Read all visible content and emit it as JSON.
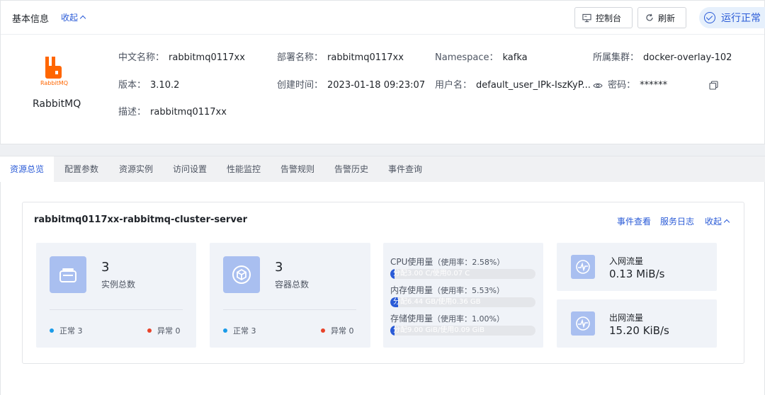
{
  "header": {
    "title": "基本信息",
    "collapse_label": "收起",
    "console_label": "控制台",
    "refresh_label": "刷新",
    "status_label": "运行正常"
  },
  "app": {
    "logo_text": "RabbitMQ",
    "name": "RabbitMQ"
  },
  "info": {
    "cn_name_label": "中文名称：",
    "cn_name": "rabbitmq0117xx",
    "deploy_name_label": "部署名称：",
    "deploy_name": "rabbitmq0117xx",
    "namespace_label": "Namespace：",
    "namespace": "kafka",
    "cluster_label": "所属集群：",
    "cluster": "docker-overlay-102",
    "version_label": "版本：",
    "version": "3.10.2",
    "created_label": "创建时间：",
    "created": "2023-01-18 09:23:07",
    "username_label": "用户名：",
    "username": "default_user_IPk-IszKyP...",
    "password_label": "密码：",
    "password": "******",
    "desc_label": "描述：",
    "desc": "rabbitmq0117xx"
  },
  "tabs": [
    {
      "label": "资源总览"
    },
    {
      "label": "配置参数"
    },
    {
      "label": "资源实例"
    },
    {
      "label": "访问设置"
    },
    {
      "label": "性能监控"
    },
    {
      "label": "告警规则"
    },
    {
      "label": "告警历史"
    },
    {
      "label": "事件查询"
    }
  ],
  "panel": {
    "title": "rabbitmq0117xx-rabbitmq-cluster-server",
    "events_link": "事件查看",
    "logs_link": "服务日志",
    "collapse_link": "收起"
  },
  "instances": {
    "count": "3",
    "label": "实例总数",
    "normal_label": "正常",
    "normal_count": "3",
    "abnormal_label": "异常",
    "abnormal_count": "0"
  },
  "containers": {
    "count": "3",
    "label": "容器总数",
    "normal_label": "正常",
    "normal_count": "3",
    "abnormal_label": "异常",
    "abnormal_count": "0"
  },
  "usage": {
    "cpu": {
      "title": "CPU使用量",
      "rate": "（使用率：2.58%）",
      "rate_value": 0.0258,
      "bar_text": "分配3.00 C/使用0.07 C"
    },
    "memory": {
      "title": "内存使用量",
      "rate": "（使用率：5.53%）",
      "rate_value": 0.0553,
      "bar_text": "分配6.44 GB/使用0.36 GB"
    },
    "storage": {
      "title": "存储使用量",
      "rate": "（使用率：1.00%）",
      "rate_value": 0.01,
      "bar_text": "分配9.00 GiB/使用0.09 GiB"
    }
  },
  "network": {
    "in_label": "入网流量",
    "in_value": "0.13 MiB/s",
    "out_label": "出网流量",
    "out_value": "15.20 KiB/s"
  },
  "colors": {
    "accent": "#2a5bd7",
    "normal_dot": "#1a9be8",
    "abnormal_dot": "#e8432a",
    "logo": "#ff6600"
  }
}
